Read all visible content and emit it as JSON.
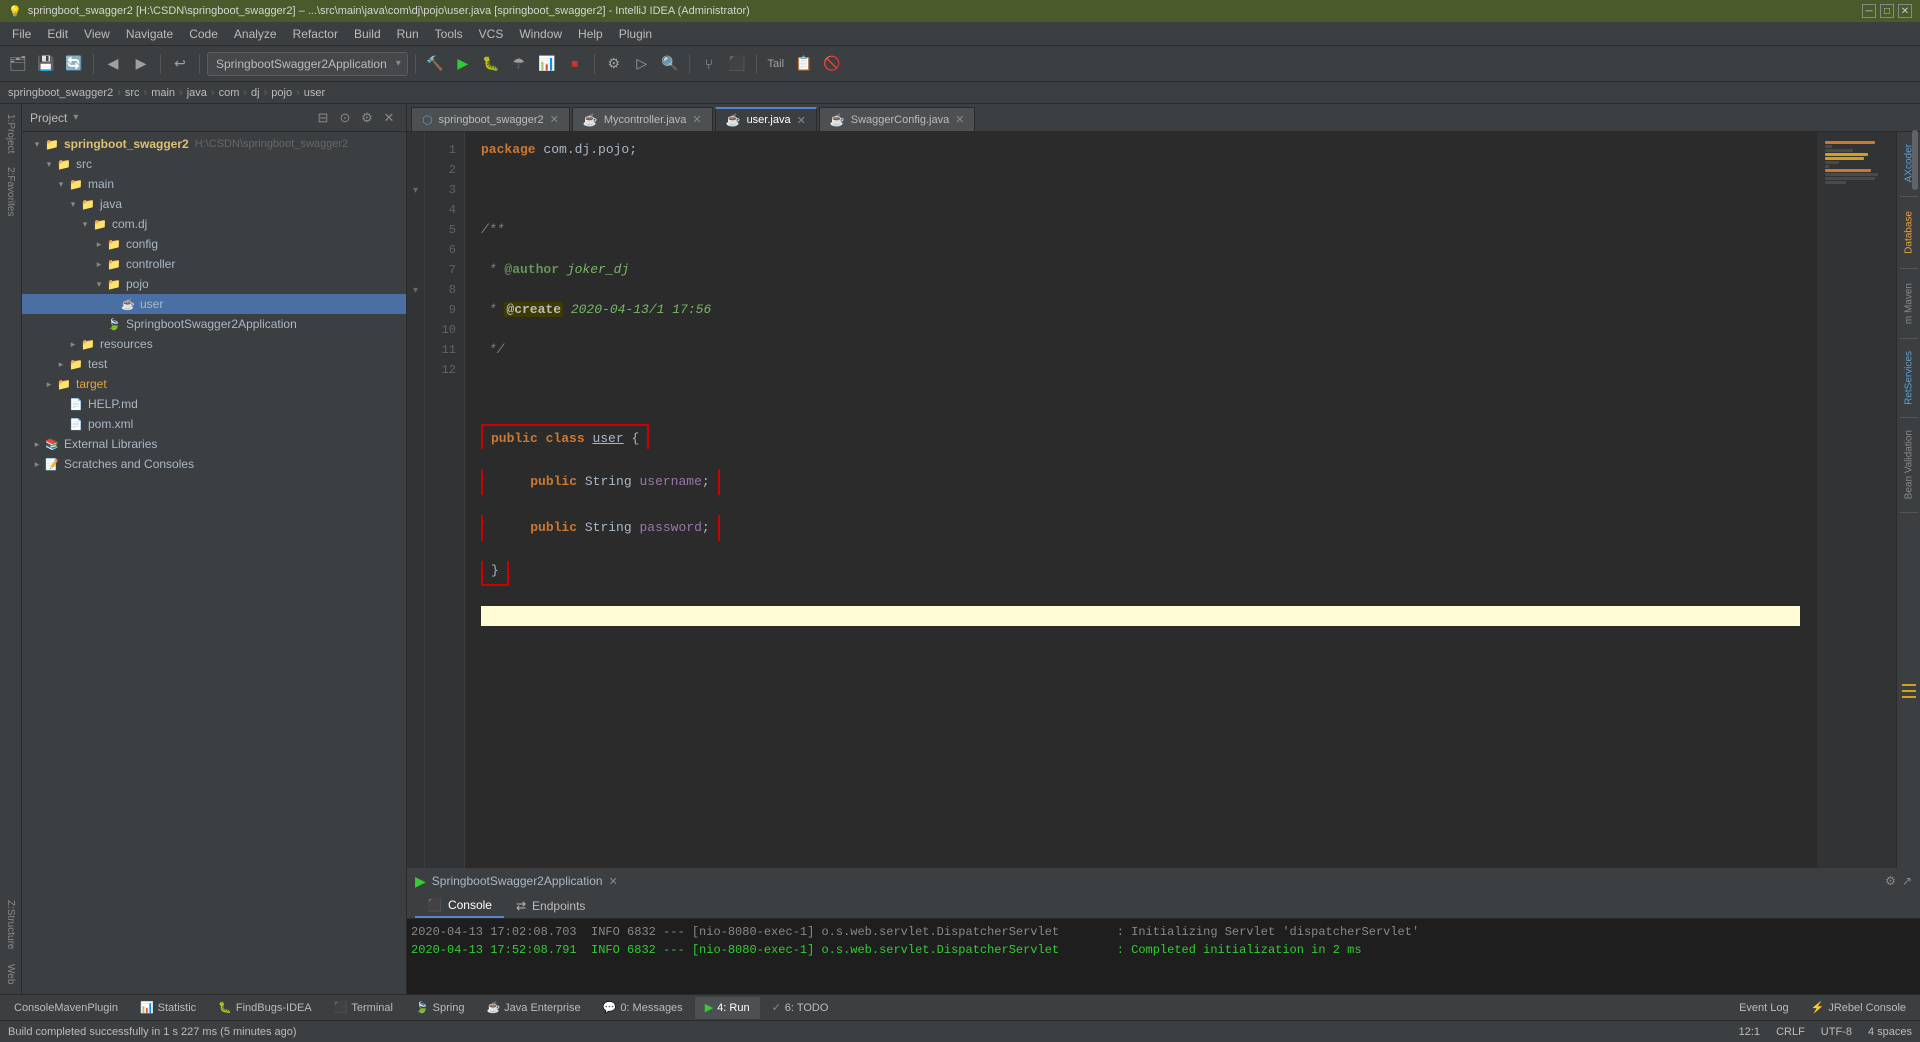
{
  "window": {
    "title": "springboot_swagger2 [H:\\CSDN\\springboot_swagger2] – ...\\src\\main\\java\\com\\dj\\pojo\\user.java [springboot_swagger2] - IntelliJ IDEA (Administrator)",
    "icon": "💡"
  },
  "menu": {
    "items": [
      "File",
      "Edit",
      "View",
      "Navigate",
      "Code",
      "Analyze",
      "Refactor",
      "Build",
      "Run",
      "Tools",
      "VCS",
      "Window",
      "Help",
      "Plugin"
    ]
  },
  "toolbar": {
    "project_dropdown": "SpringbootSwagger2Application",
    "tail_label": "Tail"
  },
  "breadcrumb": {
    "items": [
      "springboot_swagger2",
      "src",
      "main",
      "java",
      "com",
      "dj",
      "pojo",
      "user"
    ]
  },
  "project": {
    "header": "Project",
    "tree": [
      {
        "id": "root",
        "label": "springboot_swagger2",
        "path": "H:\\CSDN\\springboot_swagger2",
        "indent": 0,
        "type": "project",
        "expanded": true
      },
      {
        "id": "src",
        "label": "src",
        "indent": 1,
        "type": "folder",
        "expanded": true
      },
      {
        "id": "main",
        "label": "main",
        "indent": 2,
        "type": "folder",
        "expanded": true
      },
      {
        "id": "java",
        "label": "java",
        "indent": 3,
        "type": "folder",
        "expanded": true
      },
      {
        "id": "com_dj",
        "label": "com.dj",
        "indent": 4,
        "type": "folder",
        "expanded": true
      },
      {
        "id": "config",
        "label": "config",
        "indent": 5,
        "type": "folder",
        "expanded": false
      },
      {
        "id": "controller",
        "label": "controller",
        "indent": 5,
        "type": "folder",
        "expanded": false
      },
      {
        "id": "pojo",
        "label": "pojo",
        "indent": 5,
        "type": "folder",
        "expanded": true
      },
      {
        "id": "user",
        "label": "user",
        "indent": 6,
        "type": "java-class",
        "selected": true
      },
      {
        "id": "SpringbootSwagger2Application",
        "label": "SpringbootSwagger2Application",
        "indent": 5,
        "type": "spring"
      },
      {
        "id": "resources",
        "label": "resources",
        "indent": 3,
        "type": "folder",
        "expanded": false
      },
      {
        "id": "test",
        "label": "test",
        "indent": 2,
        "type": "folder",
        "expanded": false
      },
      {
        "id": "target",
        "label": "target",
        "indent": 1,
        "type": "folder",
        "expanded": false
      },
      {
        "id": "HELP",
        "label": "HELP.md",
        "indent": 1,
        "type": "md"
      },
      {
        "id": "pom",
        "label": "pom.xml",
        "indent": 1,
        "type": "xml"
      },
      {
        "id": "external_libs",
        "label": "External Libraries",
        "indent": 0,
        "type": "folder",
        "expanded": false
      },
      {
        "id": "scratches",
        "label": "Scratches and Consoles",
        "indent": 0,
        "type": "folder",
        "expanded": false
      }
    ]
  },
  "editor_tabs": [
    {
      "id": "tab1",
      "label": "springboot_swagger2",
      "type": "module",
      "active": false,
      "closable": true
    },
    {
      "id": "tab2",
      "label": "Mycontroller.java",
      "type": "java",
      "active": false,
      "closable": true
    },
    {
      "id": "tab3",
      "label": "user.java",
      "type": "java",
      "active": true,
      "closable": true
    },
    {
      "id": "tab4",
      "label": "SwaggerConfig.java",
      "type": "java",
      "active": false,
      "closable": true
    }
  ],
  "code": {
    "filename": "user.java",
    "lines": [
      {
        "num": 1,
        "text": "package com.dj.pojo;",
        "type": "normal"
      },
      {
        "num": 2,
        "text": "",
        "type": "normal"
      },
      {
        "num": 3,
        "text": "/**",
        "type": "comment"
      },
      {
        "num": 4,
        "text": " * @author joker_dj",
        "type": "javadoc"
      },
      {
        "num": 5,
        "text": " * @create 2020-04-13/1 17:56",
        "type": "javadoc"
      },
      {
        "num": 6,
        "text": " */",
        "type": "comment"
      },
      {
        "num": 7,
        "text": "",
        "type": "normal"
      },
      {
        "num": 8,
        "text": "public class user {",
        "type": "code"
      },
      {
        "num": 9,
        "text": "    public String username;",
        "type": "code"
      },
      {
        "num": 10,
        "text": "    public String password;",
        "type": "code"
      },
      {
        "num": 11,
        "text": "}",
        "type": "code"
      },
      {
        "num": 12,
        "text": "",
        "type": "normal"
      }
    ]
  },
  "bottom": {
    "run_label": "SpringbootSwagger2Application",
    "tabs": [
      "Console",
      "Endpoints"
    ],
    "active_tab": "Console",
    "console_lines": [
      {
        "text": "2020-04-13 17:02:08.703  INFO 6832 --- [nio-8080-exec-1] o.s.web.servlet.DispatcherServlet        : Initializing Servlet 'dispatcherServlet'",
        "type": "info"
      },
      {
        "text": "2020-04-13 17:52:08.791  INFO 6832 --- [nio-8080-exec-1] o.s.web.servlet.DispatcherServlet        : Completed initialization in 2 ms",
        "type": "info"
      }
    ]
  },
  "action_bar": {
    "items": [
      {
        "id": "consolemaven",
        "label": "ConsoleMavenPlugin",
        "type": "normal"
      },
      {
        "id": "statistic",
        "label": "Statistic",
        "type": "normal"
      },
      {
        "id": "findbugs",
        "label": "FindBugs-IDEA",
        "type": "normal"
      },
      {
        "id": "terminal",
        "label": "Terminal",
        "type": "normal"
      },
      {
        "id": "spring",
        "label": "Spring",
        "type": "normal"
      },
      {
        "id": "javaenterprise",
        "label": "Java Enterprise",
        "type": "normal"
      },
      {
        "id": "messages",
        "label": "0: Messages",
        "type": "normal"
      },
      {
        "id": "run",
        "label": "4: Run",
        "type": "active"
      },
      {
        "id": "todo",
        "label": "6: TODO",
        "type": "normal"
      },
      {
        "id": "eventlog",
        "label": "Event Log",
        "type": "right"
      },
      {
        "id": "jrebelconsole",
        "label": "JRebel Console",
        "type": "right"
      }
    ]
  },
  "status_bar": {
    "left": "Build completed successfully in 1 s 227 ms (5 minutes ago)",
    "right": {
      "position": "12:1",
      "line_ending": "CRLF",
      "encoding": "UTF-8",
      "indent": "4 spaces"
    }
  },
  "right_tool_strip": {
    "items": [
      "AXcoder",
      "Database",
      "m Maven",
      "RetServices",
      "Bean Validation"
    ]
  },
  "left_strip": {
    "items": [
      "1:Project",
      "2:Favorites",
      "Z:Structure",
      "Web"
    ]
  }
}
